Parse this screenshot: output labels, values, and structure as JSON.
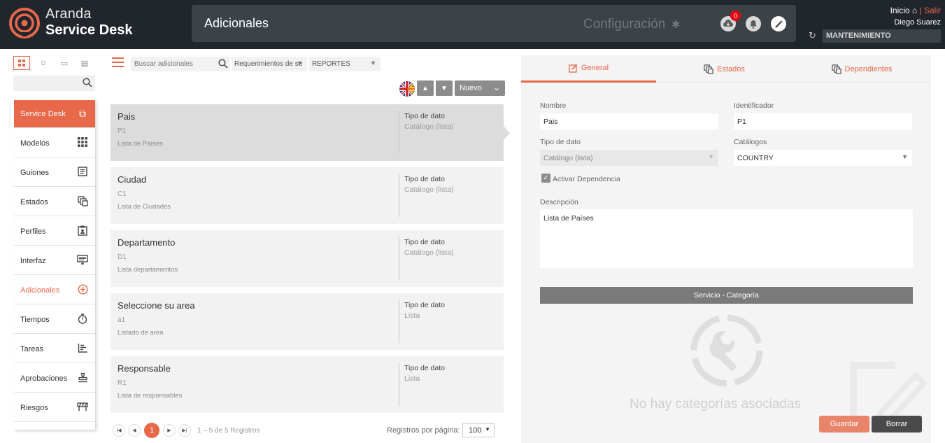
{
  "app": {
    "brand_line1": "Aranda",
    "brand_line2": "Service Desk",
    "page_title": "Adicionales",
    "config_label": "Configuración",
    "notification_count": "0",
    "home_label": "Inicio",
    "separator": "|",
    "logout_label": "Salir",
    "user_name": "Diego Suarez",
    "mode_label": "MANTENIMIENTO",
    "accent_color": "#e8684a"
  },
  "sidebar": {
    "items": [
      {
        "label": "Service Desk",
        "icon": "layers-icon"
      },
      {
        "label": "Modelos",
        "icon": "grid-icon"
      },
      {
        "label": "Guiones",
        "icon": "document-icon"
      },
      {
        "label": "Estados",
        "icon": "states-icon"
      },
      {
        "label": "Perfiles",
        "icon": "clipboard-user-icon"
      },
      {
        "label": "Interfaz",
        "icon": "monitor-icon"
      },
      {
        "label": "Adicionales",
        "icon": "plus-circle-icon"
      },
      {
        "label": "Tiempos",
        "icon": "stopwatch-icon"
      },
      {
        "label": "Tareas",
        "icon": "tasks-icon"
      },
      {
        "label": "Aprobaciones",
        "icon": "stamp-icon"
      },
      {
        "label": "Riesgos",
        "icon": "barrier-icon"
      }
    ]
  },
  "toolbar": {
    "search_placeholder": "Buscar adicionales",
    "filter1": "Requerimientos de se",
    "filter2": "REPORTES",
    "new_label": "Nuevo"
  },
  "records": [
    {
      "name": "Pais",
      "code": "P1",
      "description": "Lista de Países",
      "type_label": "Tipo de dato",
      "type_value": "Catálogo (lista)"
    },
    {
      "name": "Ciudad",
      "code": "C1",
      "description": "Lista de Ciudades",
      "type_label": "Tipo de dato",
      "type_value": "Catálogo (lista)"
    },
    {
      "name": "Departamento",
      "code": "D1",
      "description": "Lista departamentos",
      "type_label": "Tipo de dato",
      "type_value": "Catálogo (lista)"
    },
    {
      "name": "Seleccione su area",
      "code": "a1",
      "description": "Listado de area",
      "type_label": "Tipo de dato",
      "type_value": "Lista"
    },
    {
      "name": "Responsable",
      "code": "R1",
      "description": "Lista de responsables",
      "type_label": "Tipo de dato",
      "type_value": "Lista"
    }
  ],
  "pagination": {
    "current_page": "1",
    "info": "1 – 5 de 5 Registros",
    "per_page_label": "Registros por página:",
    "per_page_value": "100"
  },
  "detail": {
    "tabs": [
      "General",
      "Estados",
      "Dependientes"
    ],
    "name_label": "Nombre",
    "name_value": "Pais",
    "id_label": "Identificador",
    "id_value": "P1",
    "type_label": "Tipo de dato",
    "type_value": "Catálogo (lista)",
    "catalog_label": "Catálogos",
    "catalog_value": "COUNTRY",
    "dependency_label": "Activar Dependencia",
    "dependency_checked": true,
    "description_label": "Descripción",
    "description_value": "Lista de Países",
    "service_bar": "Servicio - Categoría",
    "empty_message": "No hay categorías asociadas",
    "save_label": "Guardar",
    "delete_label": "Borrar"
  }
}
